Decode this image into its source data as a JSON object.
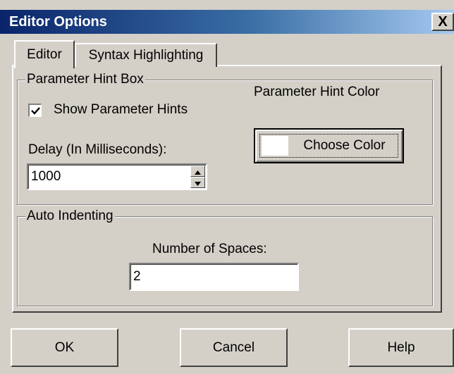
{
  "window": {
    "title": "Editor Options",
    "close_glyph": "X"
  },
  "tabs": [
    {
      "label": "Editor",
      "active": true
    },
    {
      "label": "Syntax Highlighting",
      "active": false
    }
  ],
  "parameter_hint_box": {
    "group_label": "Parameter Hint Box",
    "show_hints_label": "Show Parameter Hints",
    "show_hints_checked": true,
    "delay_label": "Delay (In Milliseconds):",
    "delay_value": "1000",
    "hint_color_label": "Parameter Hint Color",
    "choose_color_label": "Choose Color",
    "hint_color": "#ffffff"
  },
  "auto_indenting": {
    "group_label": "Auto Indenting",
    "spaces_label": "Number of Spaces:",
    "spaces_value": "2"
  },
  "buttons": {
    "ok": "OK",
    "cancel": "Cancel",
    "help": "Help"
  },
  "colors": {
    "face": "#d4d0c8",
    "titlebar_start": "#0a246a",
    "titlebar_end": "#a6caf0"
  }
}
